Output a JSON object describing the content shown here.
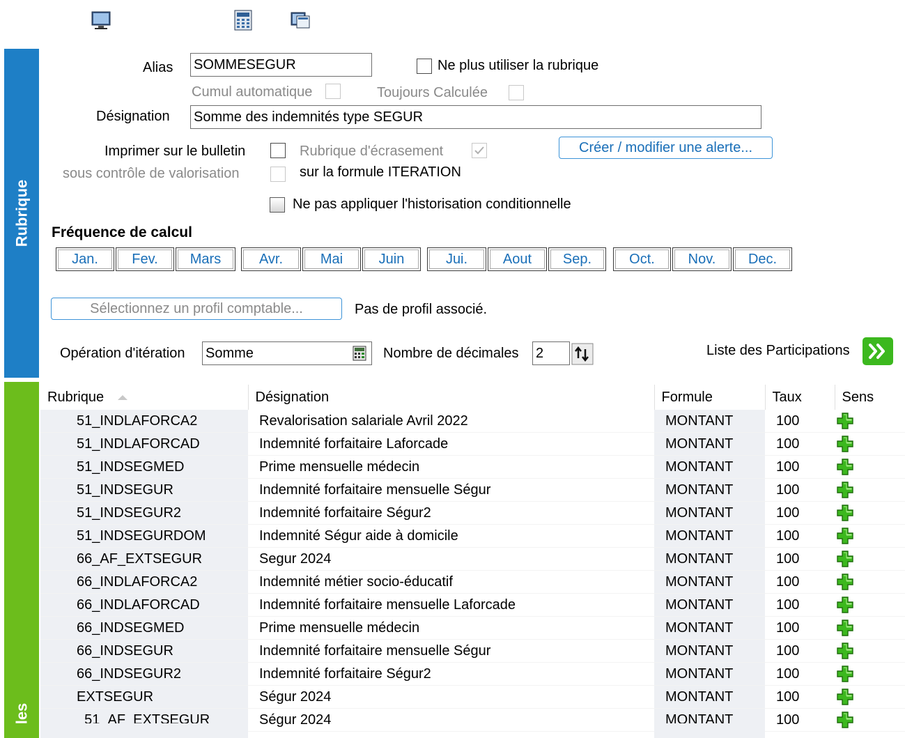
{
  "toolbar": {
    "icons": [
      "monitor-icon",
      "calculator-icon",
      "windows-icon"
    ]
  },
  "tabs": {
    "rubrique": "Rubrique",
    "second": "les"
  },
  "form": {
    "alias_label": "Alias",
    "alias_value": "SOMMESEGUR",
    "ne_plus_utiliser": "Ne plus utiliser la rubrique",
    "cumul_automatique": "Cumul automatique",
    "toujours_calculee": "Toujours Calculée",
    "designation_label": "Désignation",
    "designation_value": "Somme des indemnités type SEGUR",
    "imprimer": "Imprimer sur le bulletin",
    "sous_controle": "sous contrôle de valorisation",
    "rubrique_ecrasement": "Rubrique d'écrasement",
    "formule_iteration": "sur la formule ITERATION",
    "alerte_button": "Créer / modifier une alerte...",
    "historisation": "Ne pas appliquer l'historisation conditionnelle"
  },
  "frequence": {
    "title": "Fréquence de calcul",
    "months": [
      "Jan.",
      "Fev.",
      "Mars",
      "Avr.",
      "Mai",
      "Juin",
      "Jui.",
      "Aout",
      "Sep.",
      "Oct.",
      "Nov.",
      "Dec."
    ]
  },
  "profil": {
    "button": "Sélectionnez un profil comptable...",
    "status": "Pas de profil associé."
  },
  "iteration": {
    "label": "Opération d'itération",
    "value": "Somme",
    "decimales_label": "Nombre de décimales",
    "decimales_value": "2",
    "participations_label": "Liste des Participations"
  },
  "table": {
    "headers": {
      "rubrique": "Rubrique",
      "designation": "Désignation",
      "formule": "Formule",
      "taux": "Taux",
      "sens": "Sens"
    },
    "rows": [
      {
        "rubrique": "51_INDLAFORCA2",
        "designation": "Revalorisation salariale Avril 2022",
        "formule": "MONTANT",
        "taux": "100",
        "sens": "plus-icon"
      },
      {
        "rubrique": "51_INDLAFORCAD",
        "designation": "Indemnité forfaitaire Laforcade",
        "formule": "MONTANT",
        "taux": "100",
        "sens": "plus-icon"
      },
      {
        "rubrique": "51_INDSEGMED",
        "designation": "Prime mensuelle médecin",
        "formule": "MONTANT",
        "taux": "100",
        "sens": "plus-icon"
      },
      {
        "rubrique": "51_INDSEGUR",
        "designation": "Indemnité forfaitaire mensuelle Ségur",
        "formule": "MONTANT",
        "taux": "100",
        "sens": "plus-icon"
      },
      {
        "rubrique": "51_INDSEGUR2",
        "designation": "Indemnité forfaitaire Ségur2",
        "formule": "MONTANT",
        "taux": "100",
        "sens": "plus-icon"
      },
      {
        "rubrique": "51_INDSEGURDOM",
        "designation": "Indemnité Ségur aide à domicile",
        "formule": "MONTANT",
        "taux": "100",
        "sens": "plus-icon"
      },
      {
        "rubrique": "66_AF_EXTSEGUR",
        "designation": "Segur 2024",
        "formule": "MONTANT",
        "taux": "100",
        "sens": "plus-icon"
      },
      {
        "rubrique": "66_INDLAFORCA2",
        "designation": "Indemnité métier socio-éducatif",
        "formule": "MONTANT",
        "taux": "100",
        "sens": "plus-icon"
      },
      {
        "rubrique": "66_INDLAFORCAD",
        "designation": "Indemnité forfaitaire mensuelle Laforcade",
        "formule": "MONTANT",
        "taux": "100",
        "sens": "plus-icon"
      },
      {
        "rubrique": "66_INDSEGMED",
        "designation": "Prime mensuelle médecin",
        "formule": "MONTANT",
        "taux": "100",
        "sens": "plus-icon"
      },
      {
        "rubrique": "66_INDSEGUR",
        "designation": "Indemnité forfaitaire mensuelle Ségur",
        "formule": "MONTANT",
        "taux": "100",
        "sens": "plus-icon"
      },
      {
        "rubrique": "66_INDSEGUR2",
        "designation": "Indemnité forfaitaire Ségur2",
        "formule": "MONTANT",
        "taux": "100",
        "sens": "plus-icon"
      },
      {
        "rubrique": "EXTSEGUR",
        "designation": "Ségur 2024",
        "formule": "MONTANT",
        "taux": "100",
        "sens": "plus-icon"
      },
      {
        "rubrique": "_51_AF_EXTSEGUR",
        "designation": "Ségur 2024",
        "formule": "MONTANT",
        "taux": "100",
        "sens": "plus-icon"
      }
    ]
  },
  "colors": {
    "tab_blue": "#1e7fc6",
    "tab_green": "#6cbd1c",
    "link_blue": "#1a6fb8",
    "accent_green": "#3cb81e"
  }
}
